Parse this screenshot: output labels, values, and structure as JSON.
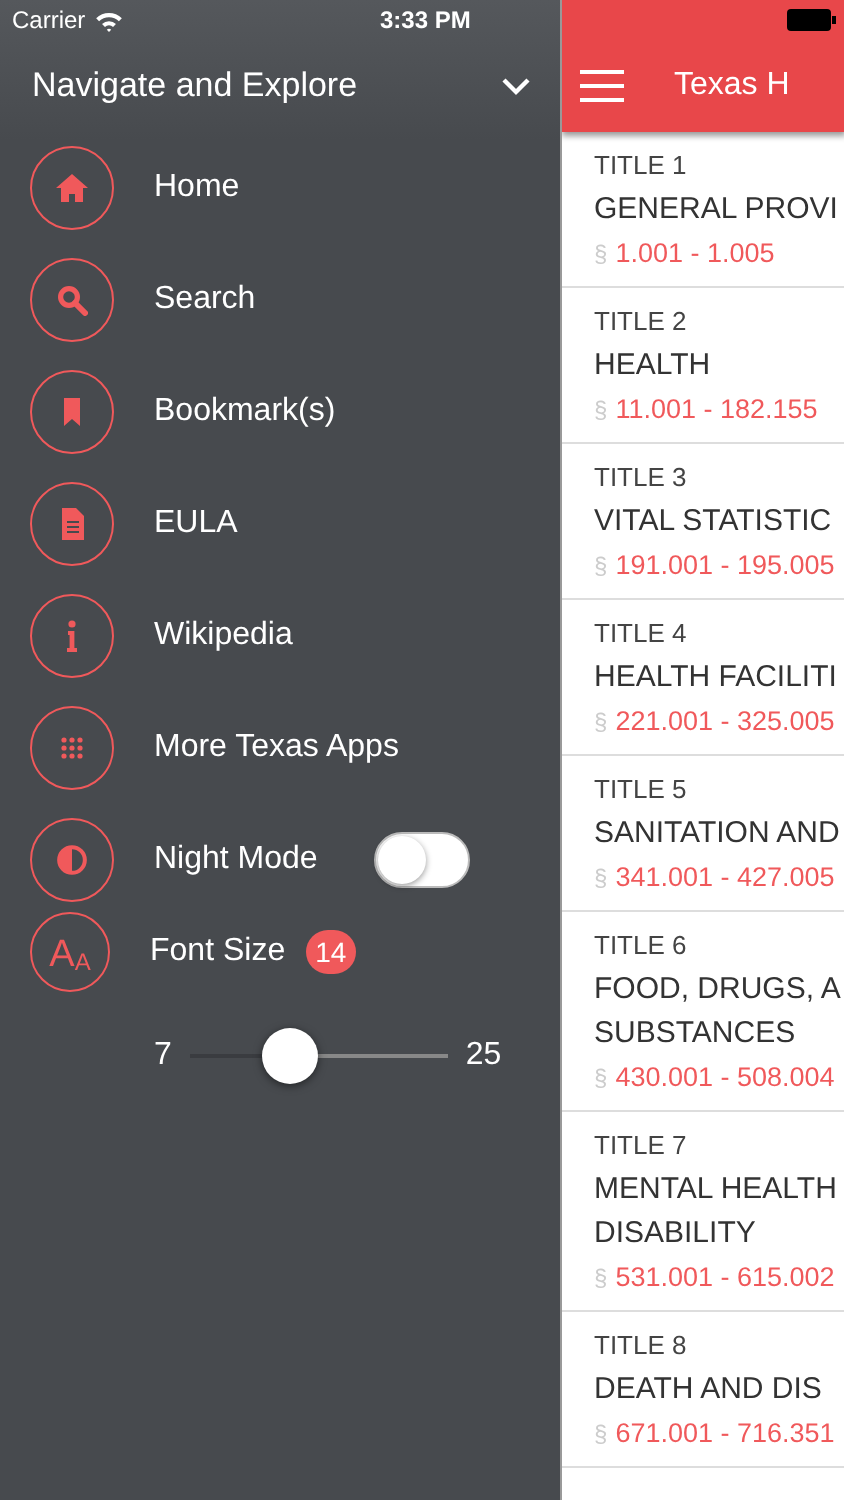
{
  "status_bar": {
    "carrier": "Carrier",
    "time": "3:33 PM"
  },
  "drawer": {
    "title": "Navigate and Explore",
    "menu": [
      {
        "label": "Home",
        "kind": "link"
      },
      {
        "label": "Search",
        "kind": "link"
      },
      {
        "label": "Bookmark(s)",
        "kind": "link"
      },
      {
        "label": "EULA",
        "kind": "link"
      },
      {
        "label": "Wikipedia",
        "kind": "link"
      },
      {
        "label": "More Texas Apps",
        "kind": "link"
      }
    ],
    "night_mode": {
      "label": "Night Mode",
      "on": false
    },
    "font_size": {
      "label": "Font Size",
      "icon_large": "A",
      "icon_small": "A",
      "badge": "14",
      "min": "7",
      "max": "25",
      "level": 0.39
    }
  },
  "main": {
    "header_title": "Texas H",
    "titles": [
      {
        "number": "TITLE 1",
        "name": "GENERAL PROVI",
        "sign": "§",
        "range": "1.001 - 1.005"
      },
      {
        "number": "TITLE 2",
        "name": "HEALTH",
        "sign": "§",
        "range": "11.001 - 182.155"
      },
      {
        "number": "TITLE 3",
        "name": "VITAL STATISTIC",
        "sign": "§",
        "range": "191.001 - 195.005"
      },
      {
        "number": "TITLE 4",
        "name": "HEALTH FACILITI",
        "sign": "§",
        "range": "221.001 - 325.005"
      },
      {
        "number": "TITLE 5",
        "name": "SANITATION AND",
        "sign": "§",
        "range": "341.001 - 427.005"
      },
      {
        "number": "TITLE 6",
        "name": "FOOD, DRUGS, A\nSUBSTANCES",
        "sign": "§",
        "range": "430.001 - 508.004"
      },
      {
        "number": "TITLE 7",
        "name": "MENTAL HEALTH\nDISABILITY",
        "sign": "§",
        "range": "531.001 - 615.002"
      },
      {
        "number": "TITLE 8",
        "name": "DEATH AND DIS",
        "sign": "§",
        "range": "671.001 - 716.351"
      }
    ]
  }
}
